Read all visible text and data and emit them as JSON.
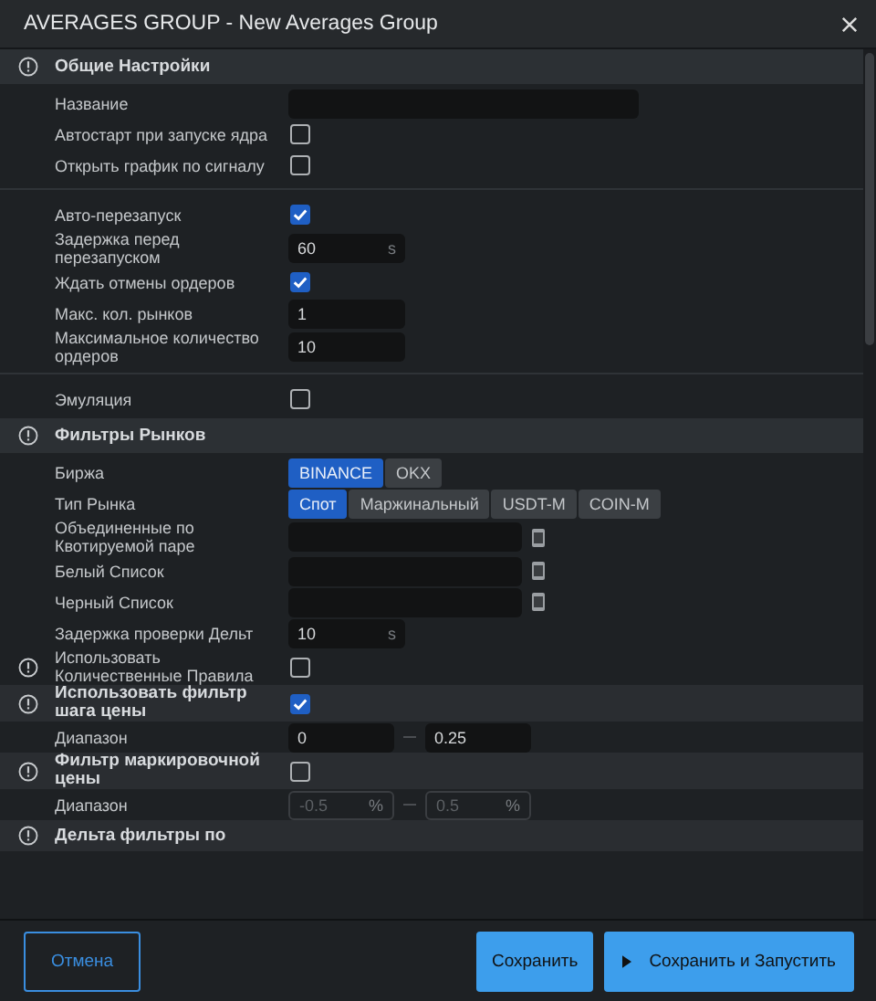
{
  "window": {
    "title": "AVERAGES GROUP - New Averages Group"
  },
  "sections": [
    {
      "title": "Общие Настройки",
      "groups": [
        [
          {
            "kind": "text",
            "label": "Название"
          },
          {
            "kind": "checkbox",
            "label": "Автостарт при запуске ядра",
            "checked": false
          },
          {
            "kind": "checkbox",
            "label": "Открыть график по сигналу",
            "checked": false
          }
        ],
        [
          {
            "kind": "checkbox",
            "label": "Авто-перезапуск",
            "checked": true
          },
          {
            "kind": "number",
            "label": "Задержка перед перезапуском",
            "value": "60",
            "unit": "s"
          },
          {
            "kind": "checkbox",
            "label": "Ждать отмены ордеров",
            "checked": true
          },
          {
            "kind": "number",
            "label": "Макс. кол. рынков",
            "value": "1"
          },
          {
            "kind": "number",
            "label": "Максимальное количество ордеров",
            "value": "10"
          }
        ],
        [
          {
            "kind": "checkbox",
            "label": "Эмуляция",
            "checked": false
          }
        ]
      ]
    },
    {
      "title": "Фильтры Рынков",
      "groups": [
        [
          {
            "kind": "segmented",
            "label": "Биржа",
            "options": [
              {
                "label": "BINANCE",
                "selected": true
              },
              {
                "label": "OKX",
                "selected": false
              }
            ]
          },
          {
            "kind": "segmented",
            "label": "Тип Рынка",
            "options": [
              {
                "label": "Спот",
                "selected": true
              },
              {
                "label": "Маржинальный",
                "selected": false
              },
              {
                "label": "USDT-M",
                "selected": false
              },
              {
                "label": "COIN-M",
                "selected": false
              }
            ]
          },
          {
            "kind": "list",
            "label": "Объединенные по Квотируемой паре"
          },
          {
            "kind": "list",
            "label": "Белый Список"
          },
          {
            "kind": "list",
            "label": "Черный Список"
          },
          {
            "kind": "number",
            "label": "Задержка проверки Дельт",
            "value": "10",
            "unit": "s"
          },
          {
            "kind": "checkbox",
            "label": "Использовать Количественные Правила",
            "checked": false,
            "alert": true
          },
          {
            "kind": "checkbox",
            "label": "Использовать фильтр шага цены",
            "checked": true,
            "alert": true,
            "emphasized": true
          },
          {
            "kind": "range",
            "label": "Диапазон",
            "from": "0",
            "to": "0.25",
            "disabled": false
          },
          {
            "kind": "checkbox",
            "label": "Фильтр маркировочной цены",
            "checked": false,
            "alert": true,
            "emphasized": true
          },
          {
            "kind": "range",
            "label": "Диапазон",
            "from": "-0.5",
            "to": "0.5",
            "unit": "%",
            "disabled": true
          },
          {
            "kind": "heading",
            "label": "Дельта фильтры по",
            "alert": true,
            "emphasized": true
          }
        ]
      ]
    }
  ],
  "footer": {
    "cancel": "Отмена",
    "save": "Сохранить",
    "save_run": "Сохранить и Запустить"
  }
}
